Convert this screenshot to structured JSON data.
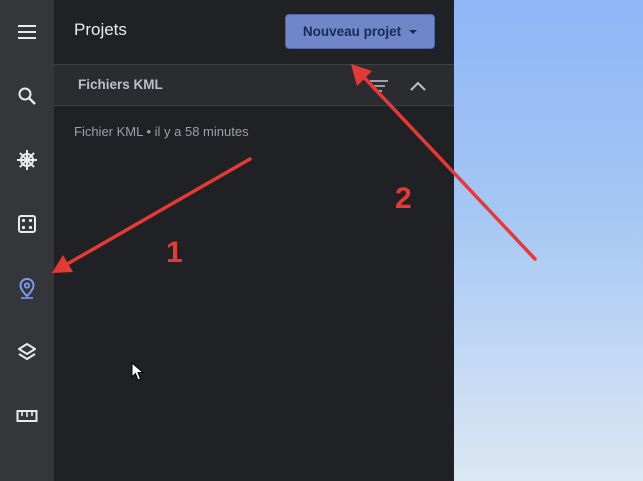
{
  "rail": {
    "items": [
      {
        "icon": "menu-icon",
        "active": false
      },
      {
        "icon": "search-icon",
        "active": false
      },
      {
        "icon": "ship-wheel-icon",
        "active": false
      },
      {
        "icon": "dice-icon",
        "active": false
      },
      {
        "icon": "map-pin-icon",
        "active": true
      },
      {
        "icon": "layers-icon",
        "active": false
      },
      {
        "icon": "ruler-icon",
        "active": false
      }
    ]
  },
  "panel": {
    "title": "Projets",
    "new_button_label": "Nouveau projet",
    "section": {
      "title": "Fichiers KML"
    },
    "items": [
      {
        "label": "Fichier KML • il y a 58 minutes"
      }
    ]
  },
  "annotations": {
    "label_1": "1",
    "label_2": "2"
  },
  "colors": {
    "accent": "#7b9cf5",
    "button_bg": "#6f86c9",
    "annotation": "#e53935"
  }
}
